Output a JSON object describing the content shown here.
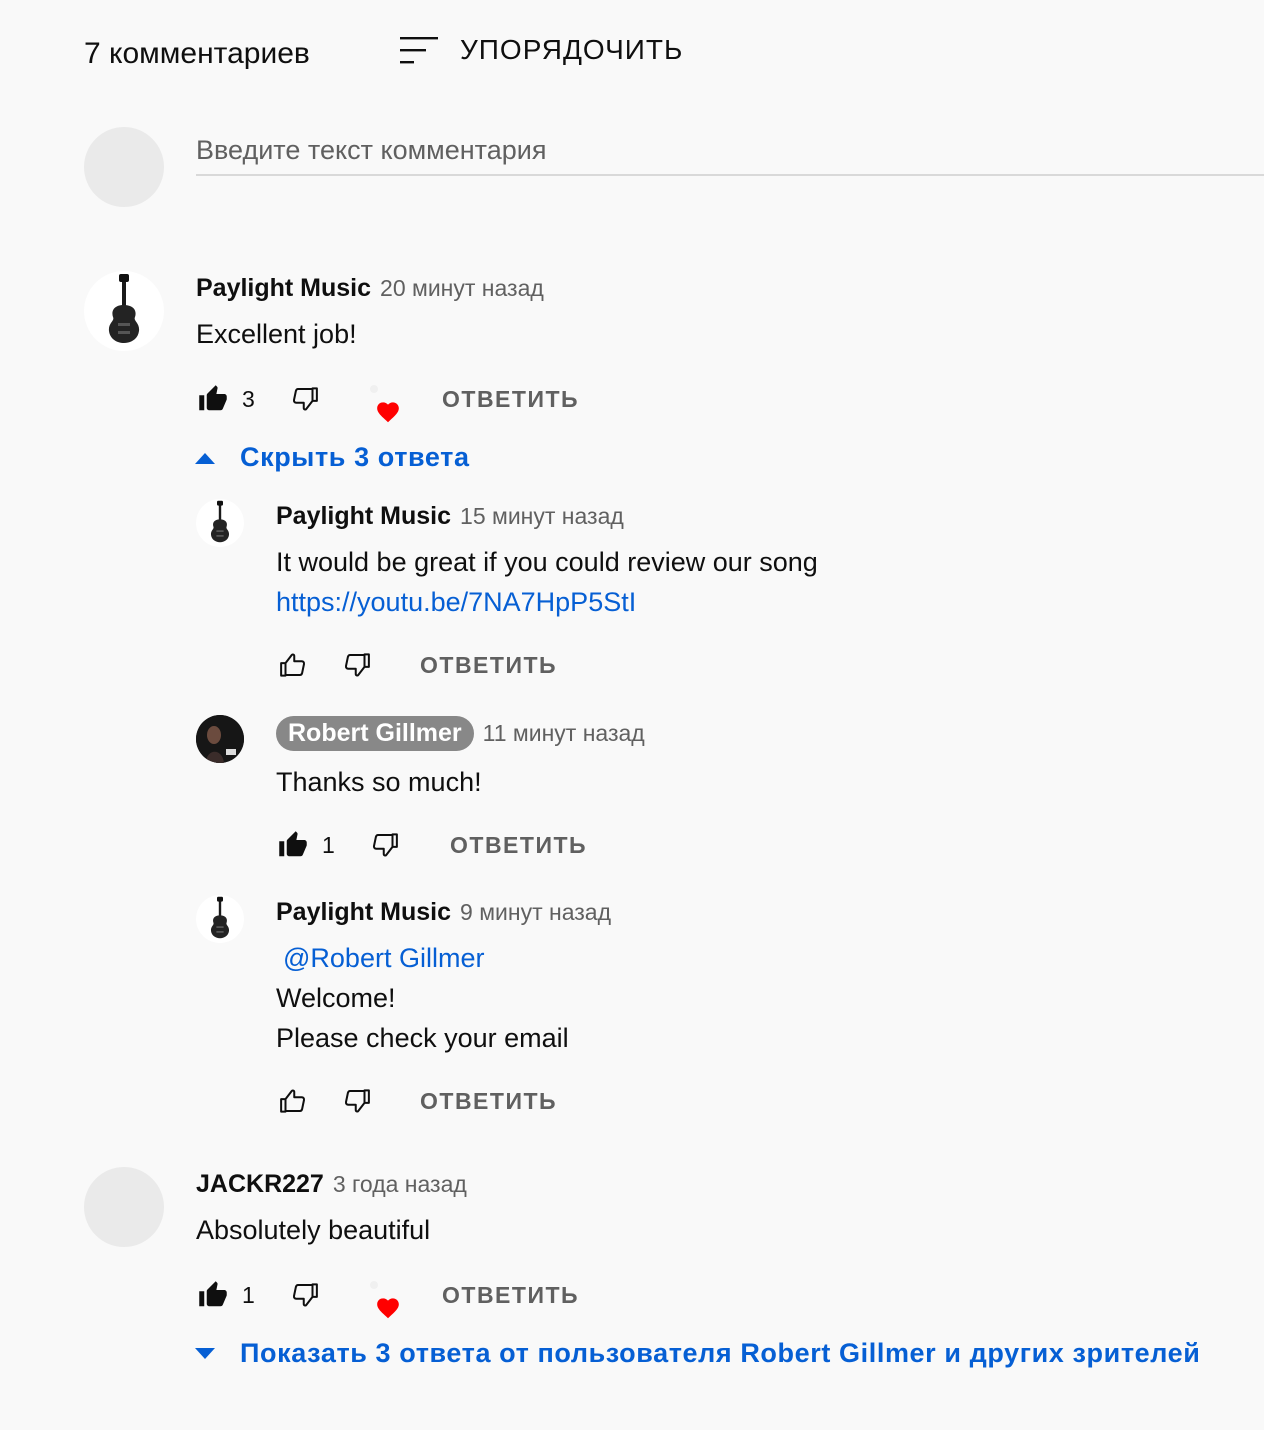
{
  "header": {
    "comment_count": "7 комментариев",
    "sort_label": "УПОРЯДОЧИТЬ"
  },
  "add_comment": {
    "placeholder": "Введите текст комментария"
  },
  "comments": [
    {
      "author": "Paylight Music",
      "time": "20 минут назад",
      "text": "Excellent job!",
      "likes": "3",
      "reply_label": "ОТВЕТИТЬ",
      "hearted": true,
      "toggle_label": "Скрыть 3 ответа",
      "replies": [
        {
          "author": "Paylight Music",
          "time": "15 минут назад",
          "text_line1": "It would be great if you could review our song",
          "link": "https://youtu.be/7NA7HpP5StI",
          "reply_label": "ОТВЕТИТЬ"
        },
        {
          "author": "Robert Gillmer",
          "time": "11 минут назад",
          "text": "Thanks so much!",
          "likes": "1",
          "reply_label": "ОТВЕТИТЬ"
        },
        {
          "author": "Paylight Music",
          "time": "9 минут назад",
          "mention": "@Robert Gillmer",
          "text_line1": "Welcome!",
          "text_line2": "Please check your email",
          "reply_label": "ОТВЕТИТЬ"
        }
      ]
    },
    {
      "author": "JACKR227",
      "time": "3 года назад",
      "text": "Absolutely beautiful",
      "likes": "1",
      "reply_label": "ОТВЕТИТЬ",
      "hearted": true,
      "toggle_label": "Показать 3 ответа от пользователя Robert Gillmer и других зрителей"
    }
  ],
  "colors": {
    "link": "#065fd4",
    "heart": "#ff0000",
    "badge": "#888888",
    "background": "#f9f9f9"
  }
}
